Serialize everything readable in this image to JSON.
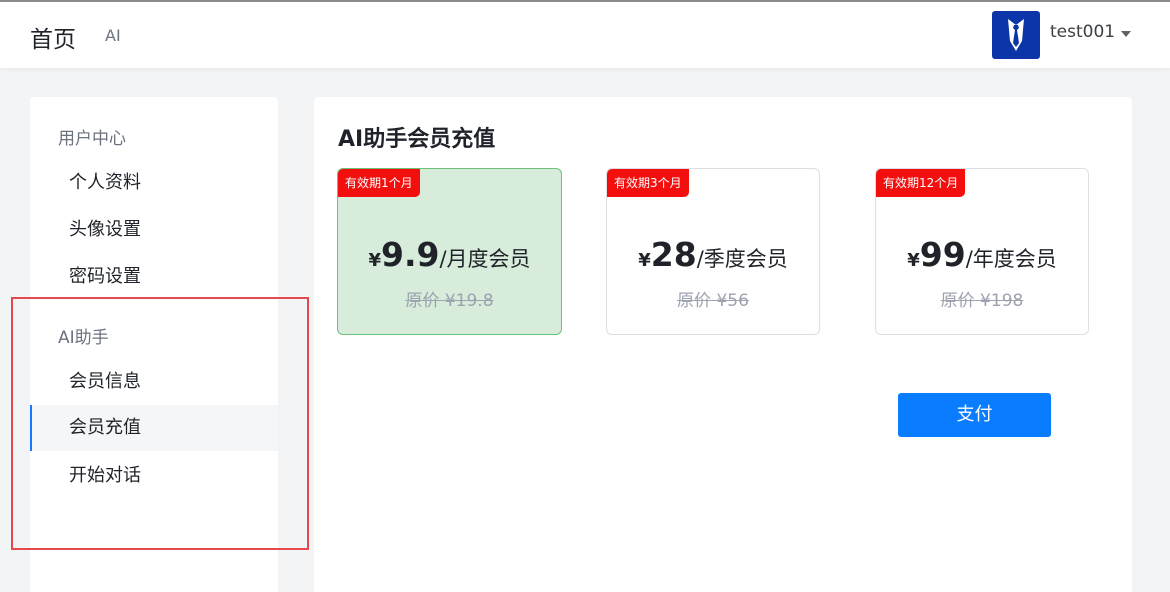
{
  "header": {
    "nav_home": "首页",
    "nav_ai": "AI",
    "username": "test001"
  },
  "sidebar": {
    "groups": [
      {
        "title": "用户中心",
        "items": [
          {
            "label": "个人资料"
          },
          {
            "label": "头像设置"
          },
          {
            "label": "密码设置"
          }
        ]
      },
      {
        "title": "AI助手",
        "items": [
          {
            "label": "会员信息"
          },
          {
            "label": "会员充值",
            "active": true
          },
          {
            "label": "开始对话"
          }
        ]
      }
    ]
  },
  "main": {
    "title": "AI助手会员充值",
    "plans": [
      {
        "tag": "有效期1个月",
        "currency": "¥",
        "price": "9.9",
        "period": "/月度会员",
        "original": "原价 ¥19.8",
        "selected": true
      },
      {
        "tag": "有效期3个月",
        "currency": "¥",
        "price": "28",
        "period": "/季度会员",
        "original": "原价 ¥56",
        "selected": false
      },
      {
        "tag": "有效期12个月",
        "currency": "¥",
        "price": "99",
        "period": "/年度会员",
        "original": "原价 ¥198",
        "selected": false
      }
    ],
    "pay_label": "支付"
  },
  "colors": {
    "accent": "#1677ff",
    "pay_button": "#0a7cff",
    "tag_red": "#f40f0f",
    "selected_card_bg": "#d7ecdb",
    "selected_card_border": "#6cc27a",
    "avatar_bg": "#0b35a8",
    "highlight_box": "#e5484d"
  },
  "icons": {
    "avatar": "tie-avatar-icon",
    "dropdown": "caret-down-icon"
  }
}
